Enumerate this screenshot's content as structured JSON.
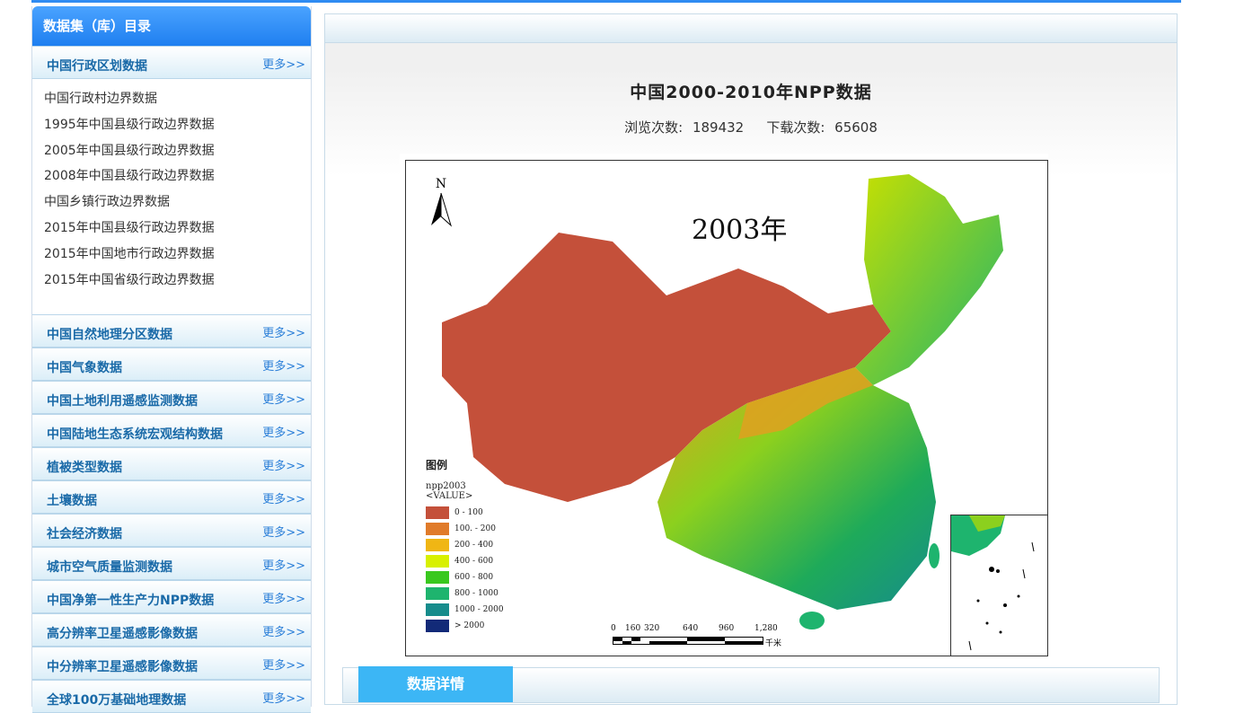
{
  "sidebar": {
    "header": "数据集（库）目录",
    "more_label": "更多>>",
    "first_category": "中国行政区划数据",
    "sub_items": [
      "中国行政村边界数据",
      "1995年中国县级行政边界数据",
      "2005年中国县级行政边界数据",
      "2008年中国县级行政边界数据",
      "中国乡镇行政边界数据",
      "2015年中国县级行政边界数据",
      "2015年中国地市行政边界数据",
      "2015年中国省级行政边界数据"
    ],
    "categories": [
      "中国自然地理分区数据",
      "中国气象数据",
      "中国土地利用遥感监测数据",
      "中国陆地生态系统宏观结构数据",
      "植被类型数据",
      "土壤数据",
      "社会经济数据",
      "城市空气质量监测数据",
      "中国净第一性生产力NPP数据",
      "高分辨率卫星遥感影像数据",
      "中分辨率卫星遥感影像数据",
      "全球100万基础地理数据"
    ]
  },
  "main": {
    "title": "中国2000-2010年NPP数据",
    "views_label": "浏览次数:",
    "views": "189432",
    "downloads_label": "下载次数:",
    "downloads": "65608",
    "details_tab": "数据详情"
  },
  "map": {
    "year_label": "2003年",
    "north_label": "N",
    "legend_title": "图例",
    "legend_layer": "npp2003",
    "legend_field": "<VALUE>",
    "legend": [
      {
        "label": "0 - 100",
        "color": "#c4503a"
      },
      {
        "label": "100. - 200",
        "color": "#e07b2a"
      },
      {
        "label": "200 - 400",
        "color": "#f0b614"
      },
      {
        "label": "400 - 600",
        "color": "#d8f000"
      },
      {
        "label": "600 - 800",
        "color": "#39c81e"
      },
      {
        "label": "800 - 1000",
        "color": "#1eb46e"
      },
      {
        "label": "1000 - 2000",
        "color": "#168c8c"
      },
      {
        "label": "> 2000",
        "color": "#122a78"
      }
    ],
    "scale_ticks": [
      "0",
      "160",
      "320",
      "640",
      "960",
      "1,280"
    ],
    "scale_unit": "千米"
  }
}
